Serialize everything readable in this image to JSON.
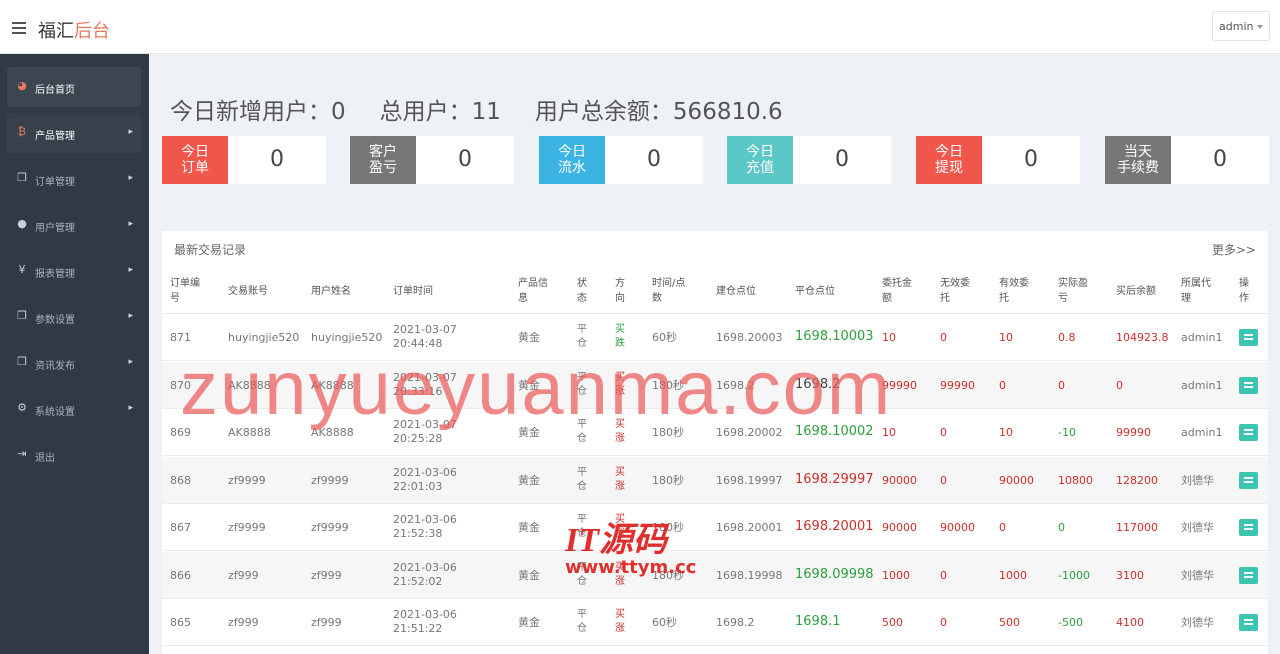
{
  "header": {
    "brand_main": "福汇",
    "brand_accent": "后台",
    "admin_label": "admin"
  },
  "sidebar": {
    "items": [
      {
        "icon": "dashboard-icon",
        "glyph": "◕",
        "label": "后台首页",
        "state": "active",
        "arrow": false
      },
      {
        "icon": "bitcoin-icon",
        "glyph": "₿",
        "label": "产品管理",
        "state": "open",
        "arrow": true
      },
      {
        "icon": "copy-icon",
        "glyph": "❐",
        "label": "订单管理",
        "state": "",
        "arrow": true
      },
      {
        "icon": "user-icon",
        "glyph": "●",
        "label": "用户管理",
        "state": "",
        "arrow": true
      },
      {
        "icon": "yen-icon",
        "glyph": "¥",
        "label": "报表管理",
        "state": "",
        "arrow": true
      },
      {
        "icon": "copy-icon",
        "glyph": "❐",
        "label": "参数设置",
        "state": "",
        "arrow": true
      },
      {
        "icon": "copy-icon",
        "glyph": "❐",
        "label": "资讯发布",
        "state": "",
        "arrow": true
      },
      {
        "icon": "gears-icon",
        "glyph": "⚙",
        "label": "系统设置",
        "state": "",
        "arrow": true
      },
      {
        "icon": "sign-out-icon",
        "glyph": "⇥",
        "label": "退出",
        "state": "",
        "arrow": false
      }
    ]
  },
  "stats": {
    "new_users": "今日新增用户：0",
    "total_users": "总用户：11",
    "total_balance": "用户总余额：566810.6",
    "cards": [
      {
        "label": "今日\n订单",
        "value": "0",
        "color": "#f0564a"
      },
      {
        "label": "客户\n盈亏",
        "value": "0",
        "color": "#777777"
      },
      {
        "label": "今日\n流水",
        "value": "0",
        "color": "#3bb3e3"
      },
      {
        "label": "今日\n充值",
        "value": "0",
        "color": "#5bc7c7"
      },
      {
        "label": "今日\n提现",
        "value": "0",
        "color": "#f0564a"
      },
      {
        "label": "当天\n手续费",
        "value": "0",
        "color": "#777777"
      }
    ]
  },
  "table": {
    "title": "最新交易记录",
    "more": "更多>>",
    "headers": [
      "订单编\n号",
      "交易账号",
      "用户姓名",
      "订单时间",
      "产品信\n息",
      "状\n态",
      "方\n向",
      "时间/点\n数",
      "建仓点位",
      "平仓点位",
      "委托金\n额",
      "无效委\n托",
      "有效委\n托",
      "实际盈\n亏",
      "买后余额",
      "所属代\n理",
      "操\n作"
    ],
    "rows": [
      {
        "id": "871",
        "account": "huyingjie520",
        "name": "huyingjie520",
        "date": "2021-03-07",
        "time": "20:44:48",
        "product": "黄金",
        "status": "平\n仓",
        "direction": "买\n跌",
        "dir_color": "green",
        "period": "60秒",
        "open": "1698.20003",
        "close": "1698.10003",
        "close_color": "green",
        "amount": "10",
        "invalid": "0",
        "valid": "10",
        "profit": "0.8",
        "profit_color": "red",
        "balance": "104923.8",
        "agent": "admin1"
      },
      {
        "id": "870",
        "account": "AK8888",
        "name": "AK8888",
        "date": "2021-03-07",
        "time": "20:33:16",
        "product": "黄金",
        "status": "平\n仓",
        "direction": "买\n涨",
        "dir_color": "red",
        "period": "180秒",
        "open": "1698.2",
        "close": "1698.2",
        "close_color": "dark",
        "amount": "99990",
        "invalid": "99990",
        "valid": "0",
        "profit": "0",
        "profit_color": "red",
        "balance": "0",
        "agent": "admin1"
      },
      {
        "id": "869",
        "account": "AK8888",
        "name": "AK8888",
        "date": "2021-03-07",
        "time": "20:25:28",
        "product": "黄金",
        "status": "平\n仓",
        "direction": "买\n涨",
        "dir_color": "red",
        "period": "180秒",
        "open": "1698.20002",
        "close": "1698.10002",
        "close_color": "green",
        "amount": "10",
        "invalid": "0",
        "valid": "10",
        "profit": "-10",
        "profit_color": "green",
        "balance": "99990",
        "agent": "admin1"
      },
      {
        "id": "868",
        "account": "zf9999",
        "name": "zf9999",
        "date": "2021-03-06",
        "time": "22:01:03",
        "product": "黄金",
        "status": "平\n仓",
        "direction": "买\n涨",
        "dir_color": "red",
        "period": "180秒",
        "open": "1698.19997",
        "close": "1698.29997",
        "close_color": "red",
        "amount": "90000",
        "invalid": "0",
        "valid": "90000",
        "profit": "10800",
        "profit_color": "red",
        "balance": "128200",
        "agent": "刘德华"
      },
      {
        "id": "867",
        "account": "zf9999",
        "name": "zf9999",
        "date": "2021-03-06",
        "time": "21:52:38",
        "product": "黄金",
        "status": "平\n仓",
        "direction": "买\n涨",
        "dir_color": "red",
        "period": "180秒",
        "open": "1698.20001",
        "close": "1698.20001",
        "close_color": "red",
        "amount": "90000",
        "invalid": "90000",
        "valid": "0",
        "profit": "0",
        "profit_color": "green",
        "balance": "117000",
        "agent": "刘德华"
      },
      {
        "id": "866",
        "account": "zf999",
        "name": "zf999",
        "date": "2021-03-06",
        "time": "21:52:02",
        "product": "黄金",
        "status": "平\n仓",
        "direction": "买\n涨",
        "dir_color": "red",
        "period": "180秒",
        "open": "1698.19998",
        "close": "1698.09998",
        "close_color": "green",
        "amount": "1000",
        "invalid": "0",
        "valid": "1000",
        "profit": "-1000",
        "profit_color": "green",
        "balance": "3100",
        "agent": "刘德华"
      },
      {
        "id": "865",
        "account": "zf999",
        "name": "zf999",
        "date": "2021-03-06",
        "time": "21:51:22",
        "product": "黄金",
        "status": "平\n仓",
        "direction": "买\n涨",
        "dir_color": "red",
        "period": "60秒",
        "open": "1698.2",
        "close": "1698.1",
        "close_color": "green",
        "amount": "500",
        "invalid": "0",
        "valid": "500",
        "profit": "-500",
        "profit_color": "green",
        "balance": "4100",
        "agent": "刘德华"
      }
    ]
  },
  "watermarks": {
    "main": "zunyueyuanma.com",
    "logo_line1": "IT源码",
    "logo_line2": "www.ttym.cc"
  }
}
